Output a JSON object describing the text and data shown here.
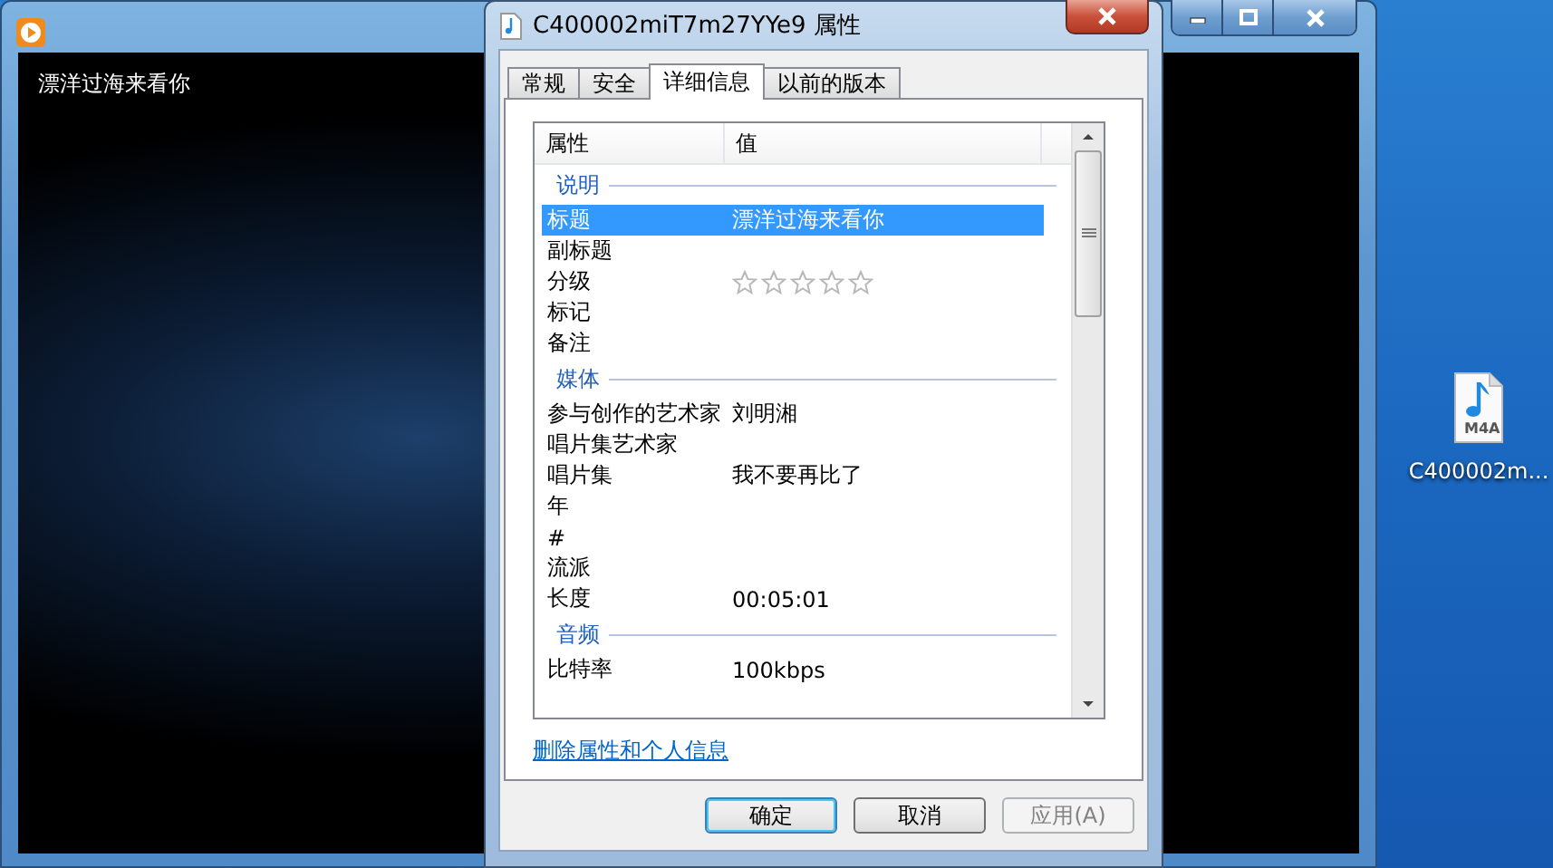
{
  "player": {
    "lyric": "漂洋过海来看你"
  },
  "dialog": {
    "title": "C400002miT7m27YYe9 属性",
    "tabs": [
      {
        "label": "常规",
        "selected": false
      },
      {
        "label": "安全",
        "selected": false
      },
      {
        "label": "详细信息",
        "selected": true
      },
      {
        "label": "以前的版本",
        "selected": false
      }
    ],
    "columns": [
      "属性",
      "值"
    ],
    "groups": [
      {
        "heading": "说明",
        "rows": [
          {
            "kind": "text",
            "name": "标题",
            "value": "漂洋过海来看你",
            "selected": true
          },
          {
            "kind": "text",
            "name": "副标题",
            "selected": false
          },
          {
            "kind": "rating",
            "name": "分级",
            "stars": 0,
            "selected": false
          },
          {
            "kind": "text",
            "name": "标记",
            "selected": false
          },
          {
            "kind": "text",
            "name": "备注",
            "selected": false
          }
        ]
      },
      {
        "heading": "媒体",
        "rows": [
          {
            "kind": "text",
            "name": "参与创作的艺术家",
            "value": "刘明湘",
            "selected": false
          },
          {
            "kind": "text",
            "name": "唱片集艺术家",
            "selected": false
          },
          {
            "kind": "text",
            "name": "唱片集",
            "value": "我不要再比了",
            "selected": false
          },
          {
            "kind": "text",
            "name": "年",
            "selected": false
          },
          {
            "kind": "text",
            "name": "#",
            "selected": false
          },
          {
            "kind": "text",
            "name": "流派",
            "selected": false
          },
          {
            "kind": "text",
            "name": "长度",
            "value": "00:05:01",
            "selected": false
          }
        ]
      },
      {
        "heading": "音频",
        "rows": [
          {
            "kind": "text",
            "name": "比特率",
            "value": "100kbps",
            "selected": false
          }
        ]
      }
    ],
    "link": "删除属性和个人信息",
    "buttons": [
      {
        "label": "确定",
        "default": true,
        "disabled": false
      },
      {
        "label": "取消",
        "default": false,
        "disabled": false
      },
      {
        "label": "应用(A)",
        "default": false,
        "disabled": true
      }
    ]
  },
  "desktop_icon": {
    "badge": "M4A",
    "label": "C400002m..."
  }
}
